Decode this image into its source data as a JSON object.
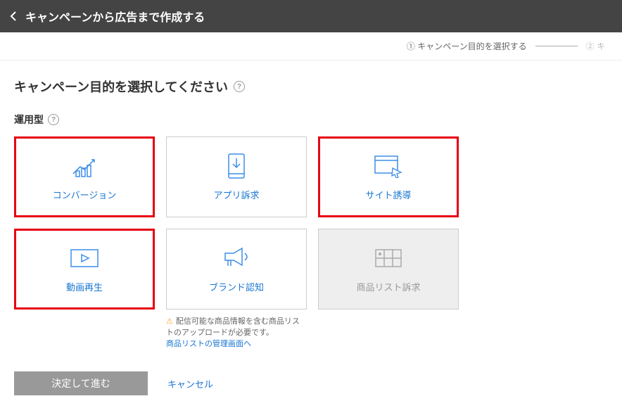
{
  "header": {
    "title": "キャンペーンから広告まで作成する"
  },
  "stepper": {
    "step1": {
      "num": "①",
      "label": "キャンペーン目的を選択する"
    },
    "step2": {
      "num": "②",
      "label": "キ"
    }
  },
  "section_title": "キャンペーン目的を選択してください",
  "subhead": "運用型",
  "cards": [
    {
      "label": "コンバージョン"
    },
    {
      "label": "アプリ訴求"
    },
    {
      "label": "サイト誘導"
    },
    {
      "label": "動画再生"
    },
    {
      "label": "ブランド認知"
    },
    {
      "label": "商品リスト訴求"
    }
  ],
  "note": {
    "text": "配信可能な商品情報を含む商品リストのアップロードが必要です。",
    "link": "商品リストの管理画面へ"
  },
  "footer": {
    "submit": "決定して進む",
    "cancel": "キャンセル"
  }
}
